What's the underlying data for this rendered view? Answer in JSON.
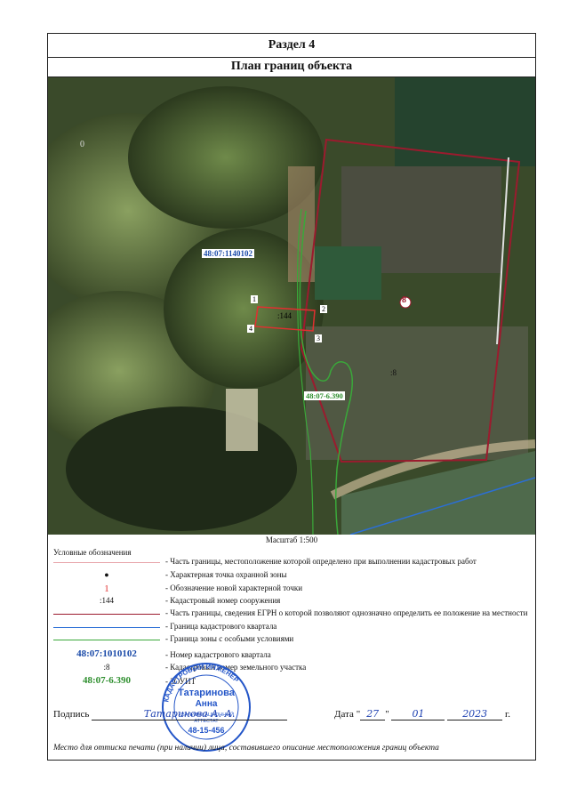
{
  "section_title": "Раздел 4",
  "plan_title": "План границ объекта",
  "map": {
    "quarter_label": "48:07:1140102",
    "zone_label": "48:07-6.390",
    "structure_label": ":144",
    "parcel_label": ":8",
    "points": [
      "1",
      "2",
      "3",
      "4"
    ],
    "marker": "8",
    "edge_digit": "0"
  },
  "scale": "Масштаб 1:500",
  "legend": {
    "title": "Условные обозначения",
    "items": [
      {
        "symbol": "",
        "text": "- Часть границы, местоположение которой определено при выполнении кадастровых работ"
      },
      {
        "symbol": "●",
        "text": "- Характерная точка охранной зоны"
      },
      {
        "symbol": "1",
        "text": "- Обозначение новой характерной точки"
      },
      {
        "symbol": ":144",
        "text": "- Кадастровый номер сооружения"
      },
      {
        "symbol": "",
        "text": "- Часть границы, сведения ЕГРН о которой позволяют однозначно определить ее положение на местности"
      },
      {
        "symbol": "",
        "text": "- Граница кадастрового квартала"
      },
      {
        "symbol": "",
        "text": "- Граница зоны с особыми условиями"
      },
      {
        "symbol": "48:07:1010102",
        "text": "- Номер кадастрового квартала"
      },
      {
        "symbol": ":8",
        "text": "- Кадастровый номер земельного участка"
      },
      {
        "symbol": "48:07-6.390",
        "text": "- ЗОУИТ"
      }
    ]
  },
  "signature": {
    "label": "Подпись",
    "handwritten": "Татаринова А. А.",
    "date_label": "Дата",
    "day": "27",
    "month": "01",
    "year": "2023",
    "year_suffix": "г."
  },
  "footer": "Место для оттиска печати (при наличии) лица, составившего описание местоположения границ объекта",
  "stamp": {
    "name": "Татаринова",
    "first": "Анна",
    "line1": "КВАЛИФИКАЦИОННЫЙ",
    "line2": "АТТЕСТАТ",
    "number": "48-15-456",
    "ring": "КАДАСТРОВЫЙ ИНЖЕНЕР"
  },
  "colors": {
    "boundary_red": "#9b1b2e",
    "new_point_red": "#e03030",
    "quarter_blue": "#2b6fd6",
    "zone_green": "#3aa83a",
    "stamp_blue": "#2456c8"
  }
}
